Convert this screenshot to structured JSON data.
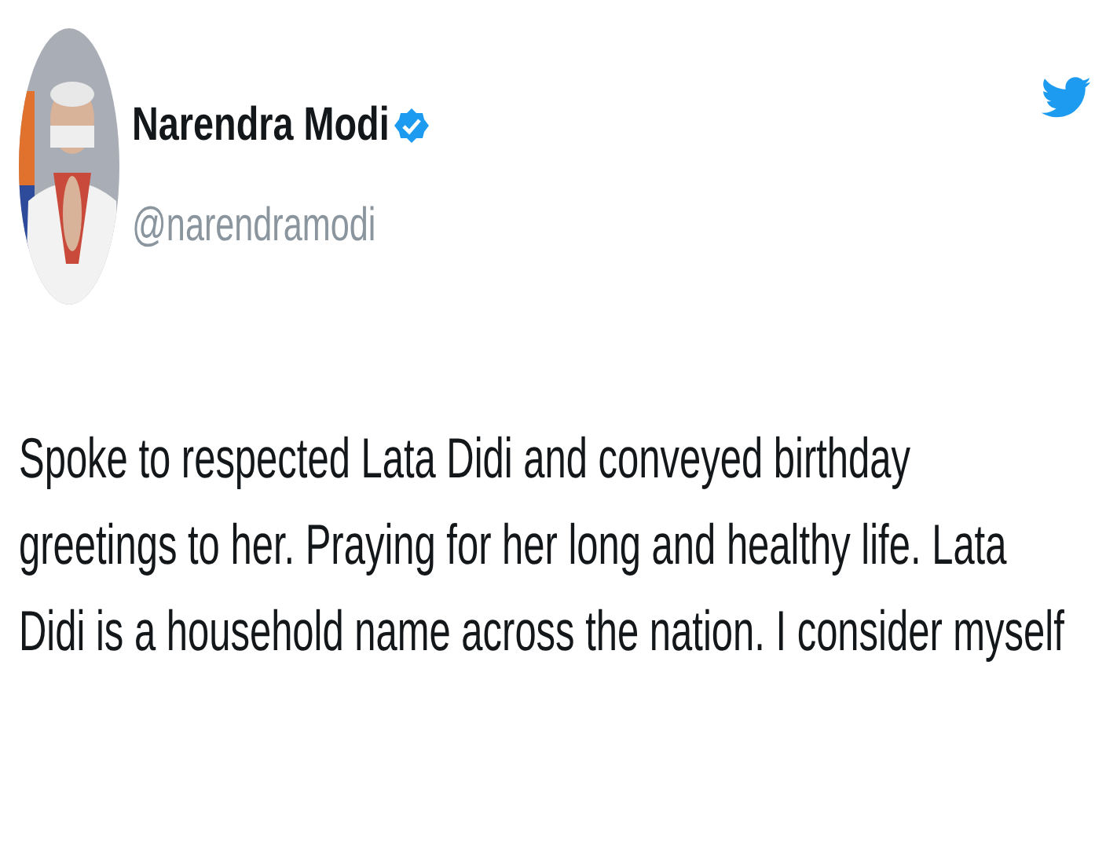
{
  "tweet": {
    "author_name": "Narendra Modi",
    "verified": true,
    "handle": "@narendramodi",
    "text_lines": [
      "Spoke to respected Lata Didi and conveyed birthday",
      "greetings to her. Praying for her long and healthy life. Lata",
      "Didi is a household name across the nation. I consider myself"
    ]
  }
}
